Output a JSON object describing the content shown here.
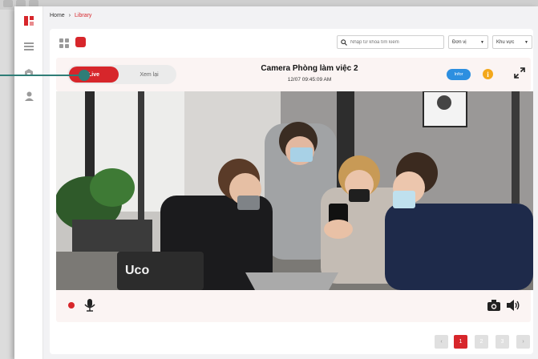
{
  "breadcrumb": {
    "home": "Home",
    "separator": "›",
    "current": "Library"
  },
  "sidebar": {
    "items": [
      {
        "icon": "logo-icon"
      },
      {
        "icon": "list-icon"
      },
      {
        "icon": "building-icon"
      },
      {
        "icon": "user-icon"
      }
    ]
  },
  "toolbar": {
    "search_placeholder": "Nhập từ khóa tìm kiếm",
    "unit_select": "Đơn vị",
    "area_select": "Khu vực"
  },
  "camera": {
    "live_label": "Live",
    "replay_label": "Xem lại",
    "title": "Camera Phòng làm việc 2",
    "timestamp": "12/07 09:45:09 AM",
    "infor_label": "Infor",
    "info_icon_text": "i",
    "laptop_sticker": "Uco"
  },
  "pagination": {
    "prev": "‹",
    "pages": [
      "1",
      "2",
      "3"
    ],
    "current": "1",
    "next": "›"
  },
  "colors": {
    "accent": "#d7262b",
    "info_blue": "#2d8fe0",
    "warning": "#f3a81c",
    "annotation": "#2f7d77"
  }
}
